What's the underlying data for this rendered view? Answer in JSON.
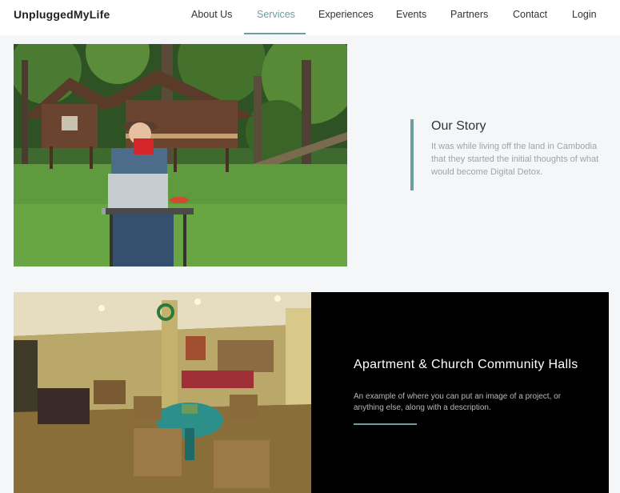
{
  "nav": {
    "brand": "UnpluggedMyLife",
    "items": [
      {
        "label": "About Us"
      },
      {
        "label": "Services"
      },
      {
        "label": "Experiences"
      },
      {
        "label": "Events"
      },
      {
        "label": "Partners"
      },
      {
        "label": "Contact"
      },
      {
        "label": "Login"
      }
    ],
    "active": "Services"
  },
  "story": {
    "title": "Our Story",
    "text": "It was while living off the land in Cambodia that they started the initial thoughts of what would become Digital Detox."
  },
  "feature": {
    "title": "Apartment & Church Community Halls",
    "text": "An example of where you can put an image of a project, or anything else, along with a description."
  },
  "colors": {
    "accent": "#6a9ea0",
    "background": "#f5f6f8",
    "dark_panel": "#000000"
  }
}
